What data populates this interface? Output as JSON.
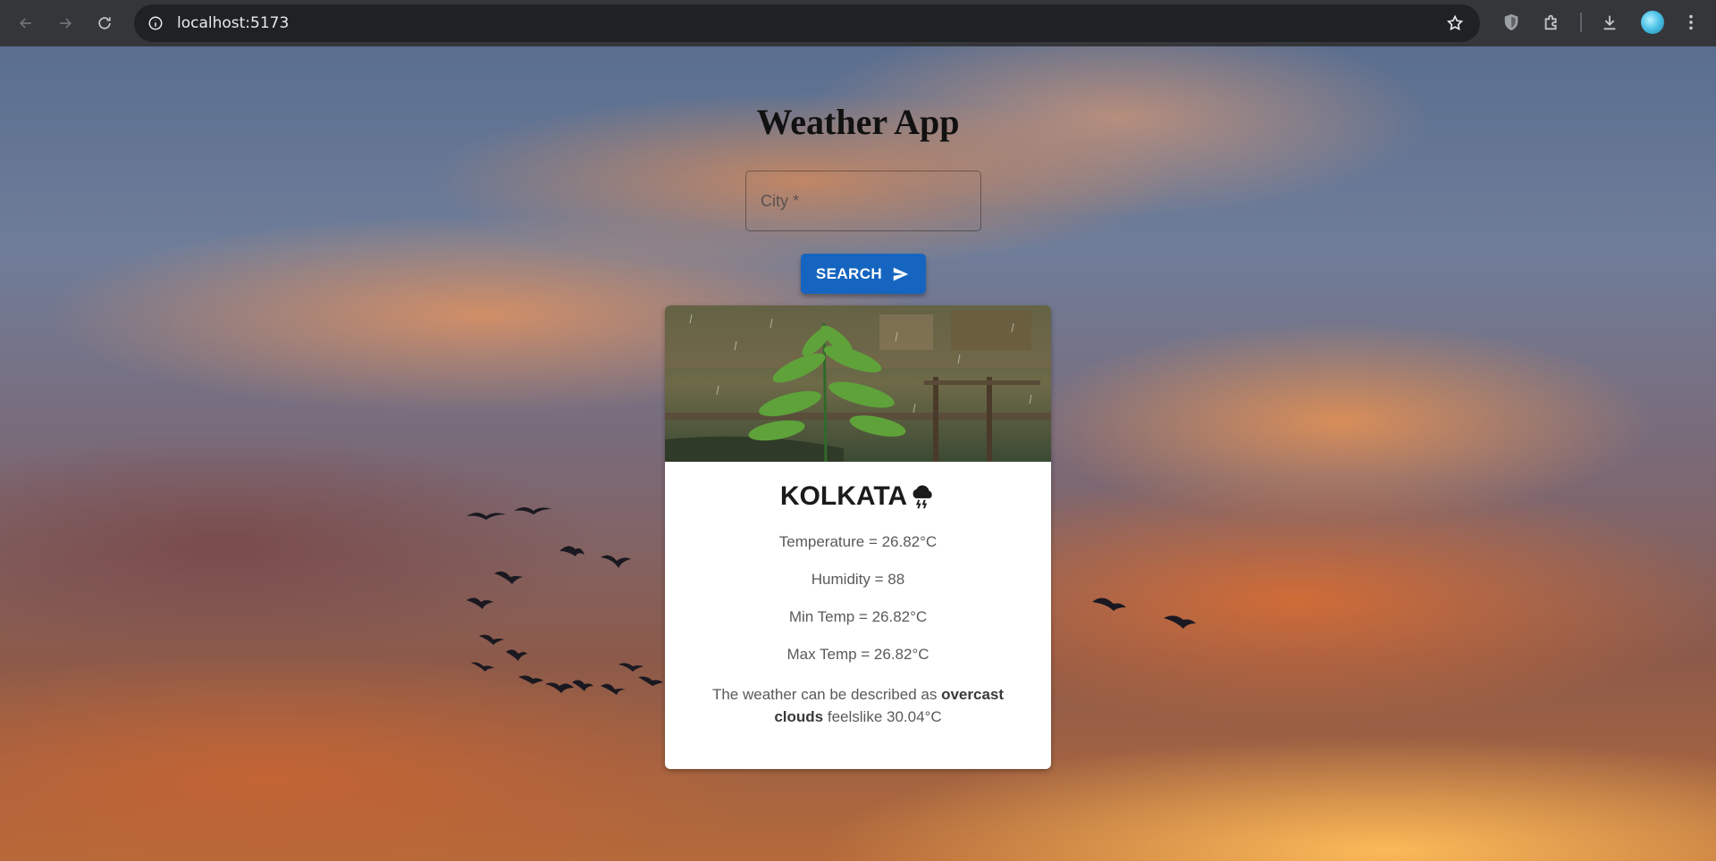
{
  "browser": {
    "url": "localhost:5173",
    "icons": [
      "back-icon",
      "forward-icon",
      "reload-icon",
      "site-info-icon",
      "star-icon",
      "shield-extension-icon",
      "extensions-icon",
      "download-icon",
      "profile-avatar",
      "menu-icon"
    ]
  },
  "app": {
    "title": "Weather App",
    "search": {
      "placeholder": "City *",
      "value": "",
      "button_label": "SEARCH"
    },
    "card": {
      "city": "KOLKATA",
      "weather_icon": "thunderstorm-cloud-icon",
      "temperature": "Temperature = 26.82°C",
      "humidity": "Humidity = 88",
      "min_temp": "Min Temp = 26.82°C",
      "max_temp": "Max Temp = 26.82°C",
      "desc_prefix": "The weather can be described as",
      "desc_condition": "overcast clouds",
      "desc_suffix": "feelslike 30.04°C"
    }
  },
  "colors": {
    "button": "#1565c0",
    "chrome": "#35363a",
    "omnibox": "#202124"
  }
}
